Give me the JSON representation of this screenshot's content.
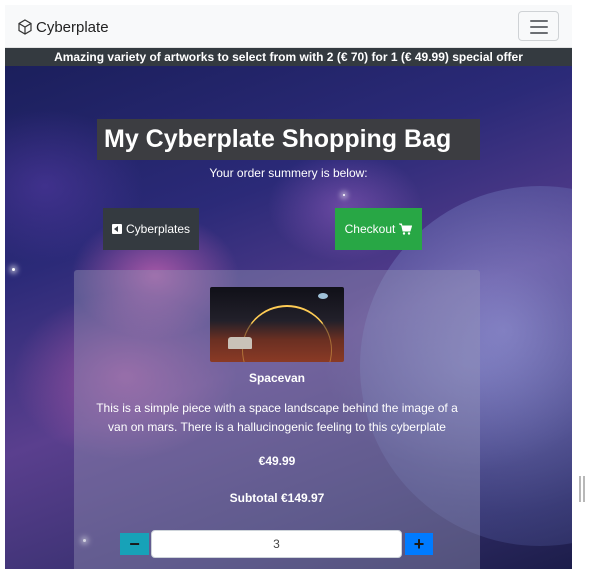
{
  "navbar": {
    "brand": "Cyberplate",
    "brand_icon": "cube-logo-icon",
    "menu_icon": "hamburger-menu-icon"
  },
  "banner": {
    "text": "Amazing variety of artworks to select from with 2 (€ 70) for 1 (€ 49.99) special offer"
  },
  "page": {
    "title": "My Cyberplate Shopping Bag",
    "subtitle": "Your order summery is below:"
  },
  "actions": {
    "back_label": "Cyberplates",
    "back_icon": "caret-left-square-icon",
    "checkout_label": "Checkout",
    "checkout_icon": "shopping-cart-icon"
  },
  "cart_item": {
    "name": "Spacevan",
    "image_icon": "spacevan-artwork",
    "description": "This is a simple piece with a space landscape behind the image of a van on mars. There is a hallucinogenic feeling to this cyberplate",
    "price": "€49.99",
    "subtotal": "Subtotal €149.97",
    "quantity": "3",
    "minus_label": "−",
    "plus_label": "+"
  },
  "colors": {
    "checkout_green": "#28a745",
    "dark_button": "#343a40",
    "minus_teal": "#17a2b8",
    "plus_blue": "#007bff"
  }
}
